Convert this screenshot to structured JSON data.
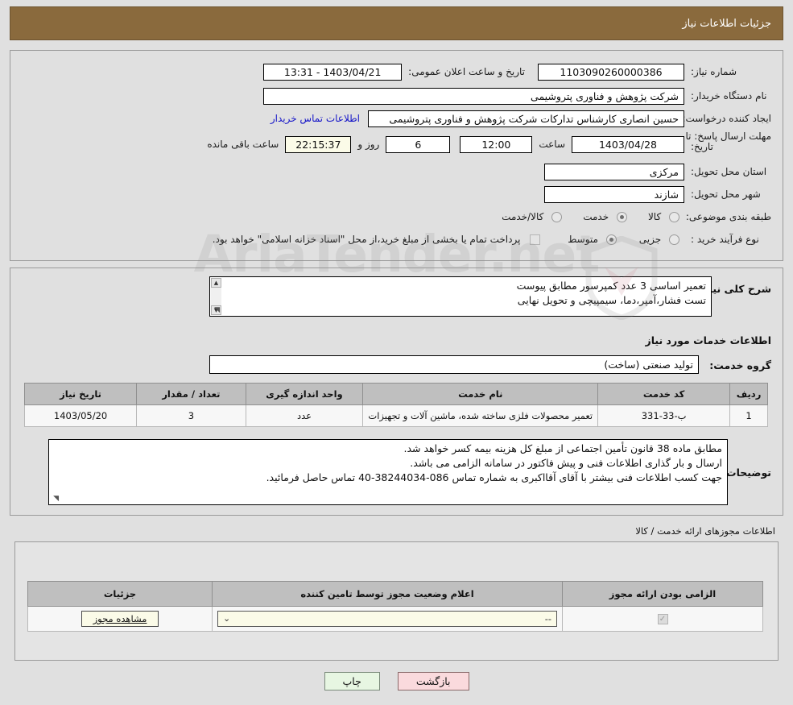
{
  "header": {
    "title": "جزئیات اطلاعات نیاز"
  },
  "watermark": {
    "text": "AriaTender.net",
    "shield_icon": "shield-icon"
  },
  "main": {
    "need_number_label": "شماره نیاز:",
    "need_number_value": "1103090260000386",
    "public_announce_label": "تاریخ و ساعت اعلان عمومی:",
    "public_announce_value": "1403/04/21 - 13:31",
    "buyer_org_label": "نام دستگاه خریدار:",
    "buyer_org_value": "شرکت پژوهش و فناوری پتروشیمی",
    "requester_label": "ایجاد کننده درخواست:",
    "requester_value": "حسین انصاری کارشناس تدارکات شرکت پژوهش و فناوری پتروشیمی",
    "contact_link": "اطلاعات تماس خریدار",
    "deadline_label_l1": "مهلت ارسال پاسخ: تا",
    "deadline_label_l2": "تاریخ:",
    "deadline_date": "1403/04/28",
    "hour_label": "ساعت",
    "hour_value": "12:00",
    "days_value": "6",
    "days_and_label": "روز و",
    "countdown_value": "22:15:37",
    "remaining_label": "ساعت باقی مانده",
    "province_label": "استان محل تحویل:",
    "province_value": "مرکزی",
    "city_label": "شهر محل تحویل:",
    "city_value": "شازند",
    "category_label": "طبقه بندی موضوعی:",
    "category_options": [
      {
        "label": "کالا",
        "selected": false
      },
      {
        "label": "خدمت",
        "selected": true
      },
      {
        "label": "کالا/خدمت",
        "selected": false
      }
    ],
    "process_label": "نوع فرآیند خرید :",
    "process_options": [
      {
        "label": "جزیی",
        "selected": false
      },
      {
        "label": "متوسط",
        "selected": true
      }
    ],
    "treasury_checkbox_label": "پرداخت تمام یا بخشی از مبلغ خرید،از محل \"اسناد خزانه اسلامی\" خواهد بود.",
    "treasury_checked": false
  },
  "description": {
    "general_need_label": "شرح کلی نیاز:",
    "general_need_lines": [
      "تعمیر اساسی 3 عدد کمپرسور مطابق پیوست",
      "تست فشار،آمپر،دما، سیمپیچی و تحویل نهایی"
    ],
    "services_heading": "اطلاعات خدمات مورد نیاز",
    "service_group_label": "گروه خدمت:",
    "service_group_value": "تولید صنعتی (ساخت)",
    "buyer_notes_label": "توضیحات خریدار:",
    "buyer_notes_lines": [
      "مطابق ماده 38 قانون تأمین اجتماعی از مبلغ کل هزینه بیمه کسر خواهد شد.",
      "ارسال و بار گذاری اطلاعات فنی و پیش فاکتور در سامانه الزامی می باشد.",
      "جهت کسب اطلاعات فنی بیشتر با آقای آقااکبری به شماره تماس  086-38244034-40 تماس حاصل فرمائید."
    ]
  },
  "service_table": {
    "columns": [
      "ردیف",
      "کد خدمت",
      "نام خدمت",
      "واحد اندازه گیری",
      "تعداد / مقدار",
      "تاریخ نیاز"
    ],
    "rows": [
      {
        "row": "1",
        "code": "ب-33-331",
        "name": "تعمیر محصولات فلزی ساخته شده، ماشین آلات و تجهیزات",
        "unit": "عدد",
        "quantity": "3",
        "need_date": "1403/05/20"
      }
    ]
  },
  "licenses": {
    "caption": "اطلاعات مجوزهای ارائه خدمت / کالا",
    "columns": [
      "الزامی بودن ارائه مجوز",
      "اعلام وضعیت مجوز توسط تامین کننده",
      "جزئیات"
    ],
    "rows": [
      {
        "required_checked": true,
        "status_value": "--",
        "details_button": "مشاهده مجوز"
      }
    ]
  },
  "footer": {
    "back_button": "بازگشت",
    "print_button": "چاپ"
  },
  "colors": {
    "header_bar": "#8a6a3d",
    "page_bg": "#e0e0e0",
    "link": "#1414c8",
    "table_header": "#bfbfbf",
    "cream_field": "#fbfbe8",
    "back_button": "#fadadd",
    "print_button": "#e7f6e2"
  }
}
